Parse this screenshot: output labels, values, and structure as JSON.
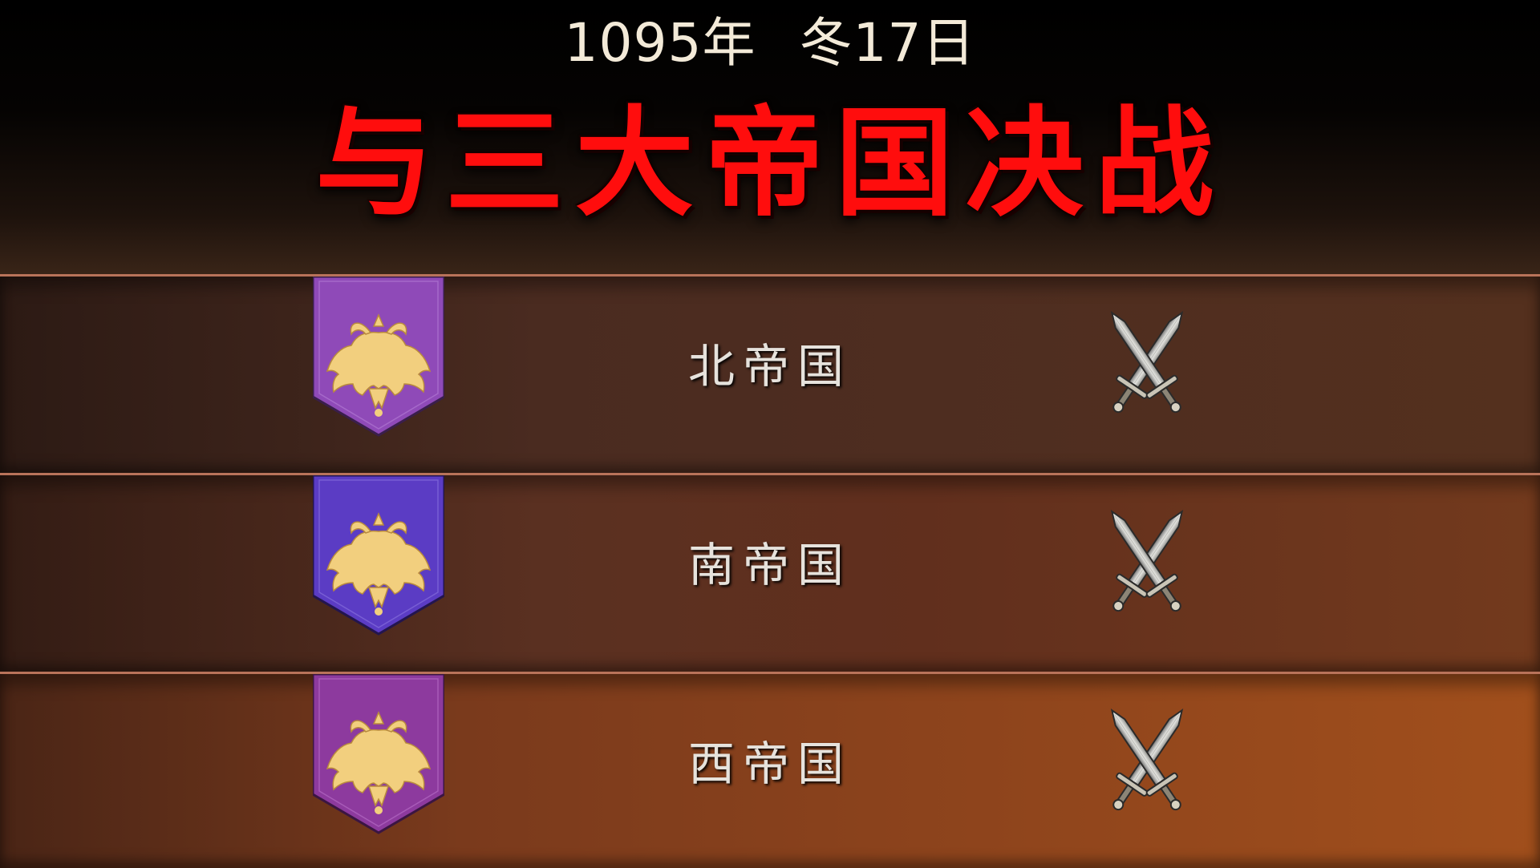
{
  "header": {
    "year": "1095年",
    "day": "冬17日",
    "title": "与三大帝国决战"
  },
  "factions": [
    {
      "name": "北帝国",
      "banner_color": "#8f4ab8",
      "emblem": "double-headed-eagle-icon",
      "action_icon": "crossed-swords-icon"
    },
    {
      "name": "南帝国",
      "banner_color": "#5b3cc4",
      "emblem": "double-headed-eagle-icon",
      "action_icon": "crossed-swords-icon"
    },
    {
      "name": "西帝国",
      "banner_color": "#8d3a9e",
      "emblem": "double-headed-eagle-icon",
      "action_icon": "crossed-swords-icon"
    }
  ],
  "colors": {
    "title_red": "#ff0d0d",
    "emblem_gold": "#f2cf7e"
  }
}
